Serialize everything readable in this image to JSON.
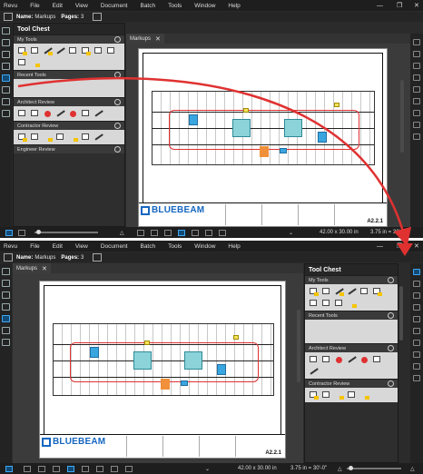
{
  "menu": [
    "Revu",
    "File",
    "Edit",
    "View",
    "Document",
    "Batch",
    "Tools",
    "Window",
    "Help"
  ],
  "namebar": {
    "name_label": "Name:",
    "name_value": "Markups",
    "pages_label": "Pages:",
    "pages_value": "3"
  },
  "tool_chest": {
    "title": "Tool Chest",
    "sections": [
      {
        "label": "My Tools"
      },
      {
        "label": "Recent Tools"
      },
      {
        "label": "Architect Review"
      },
      {
        "label": "Contractor Review"
      },
      {
        "label": "Engineer Review"
      }
    ]
  },
  "tab": {
    "label": "Markups"
  },
  "titleblock": {
    "logo_text": "BLUEBEAM",
    "sheet_number": "A2.2.1"
  },
  "status": {
    "page_size": "42.00 x 30.00 in",
    "scale": "3.75 in = 30'-0\""
  },
  "colors": {
    "accent": "#3fa9f5",
    "arrow": "#e03131",
    "brand": "#1566c0"
  }
}
